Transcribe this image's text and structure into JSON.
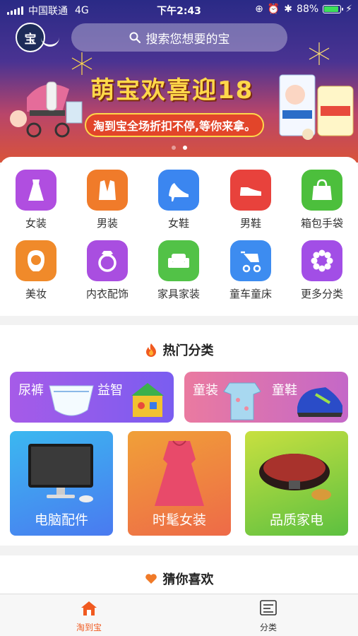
{
  "status_bar": {
    "carrier": "中国联通",
    "network": "4G",
    "time": "下午2:43",
    "battery": "88%",
    "battery_level": 0.88
  },
  "header": {
    "logo_text": "宝",
    "search_placeholder": "搜索您想要的宝"
  },
  "banner": {
    "title": "萌宝欢喜迎18",
    "subtitle": "淘到宝全场折扣不停,等你来拿。",
    "page_count": 2,
    "active_page": 2
  },
  "categories": [
    {
      "label": "女装",
      "icon": "dress-icon",
      "color": "#b04ee0"
    },
    {
      "label": "男装",
      "icon": "suit-icon",
      "color": "#f07b2a"
    },
    {
      "label": "女鞋",
      "icon": "high-heel-icon",
      "color": "#3b86f0"
    },
    {
      "label": "男鞋",
      "icon": "shoe-icon",
      "color": "#e8423c"
    },
    {
      "label": "箱包手袋",
      "icon": "handbag-icon",
      "color": "#4cbf3c"
    },
    {
      "label": "美妆",
      "icon": "woman-face-icon",
      "color": "#f08a2a"
    },
    {
      "label": "内衣配饰",
      "icon": "ring-icon",
      "color": "#a94ee0"
    },
    {
      "label": "家具家装",
      "icon": "sofa-icon",
      "color": "#52c247"
    },
    {
      "label": "童车童床",
      "icon": "stroller-icon",
      "color": "#3d8cf0"
    },
    {
      "label": "更多分类",
      "icon": "flower-icon",
      "color": "#a24ee6"
    }
  ],
  "hot": {
    "title": "热门分类",
    "banners": [
      {
        "left": "尿裤",
        "right": "益智",
        "color_from": "#a65be8",
        "color_to": "#7a5df0"
      },
      {
        "left": "童装",
        "right": "童鞋",
        "color_from": "#ea7aa0",
        "color_to": "#c468c8"
      }
    ],
    "tiles": [
      {
        "label": "电脑配件",
        "color_from": "#3bb8f0",
        "color_to": "#4a7af0"
      },
      {
        "label": "时髦女装",
        "color_from": "#f0a038",
        "color_to": "#ee6a48"
      },
      {
        "label": "品质家电",
        "color_from": "#c8e040",
        "color_to": "#5cc040"
      }
    ]
  },
  "guess": {
    "title": "猜你喜欢"
  },
  "tabbar": {
    "items": [
      {
        "label": "淘到宝",
        "active": true
      },
      {
        "label": "分类",
        "active": false
      }
    ],
    "active_color": "#f05a20"
  }
}
